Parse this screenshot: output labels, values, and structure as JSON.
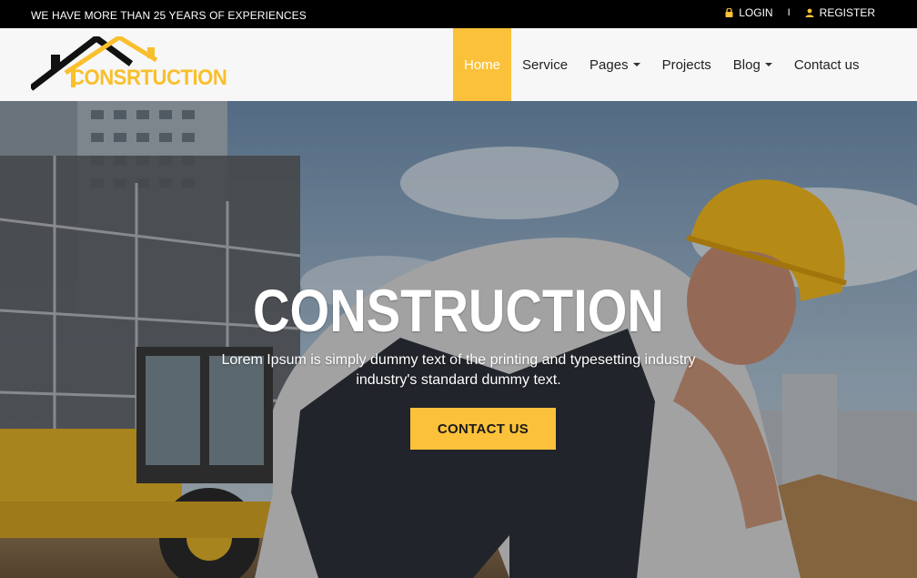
{
  "topbar": {
    "tagline": "WE HAVE MORE THAN 25 YEARS OF EXPERIENCES",
    "login": "LOGIN",
    "separator": "I",
    "register": "REGISTER"
  },
  "logo": {
    "text": "CONSRTUCTION"
  },
  "nav": {
    "items": [
      {
        "label": "Home",
        "active": true
      },
      {
        "label": "Service"
      },
      {
        "label": "Pages",
        "dropdown": true
      },
      {
        "label": "Projects"
      },
      {
        "label": "Blog",
        "dropdown": true
      },
      {
        "label": "Contact us"
      }
    ]
  },
  "hero": {
    "title": "CONSTRUCTION",
    "text": "Lorem Ipsum is simply dummy text of the printing and typesetting industry industry's standard dummy text.",
    "button": "CONTACT US"
  },
  "colors": {
    "accent": "#fbc13a",
    "topbar": "#000000"
  },
  "icons": {
    "login": "lock-icon",
    "register": "user-icon"
  }
}
